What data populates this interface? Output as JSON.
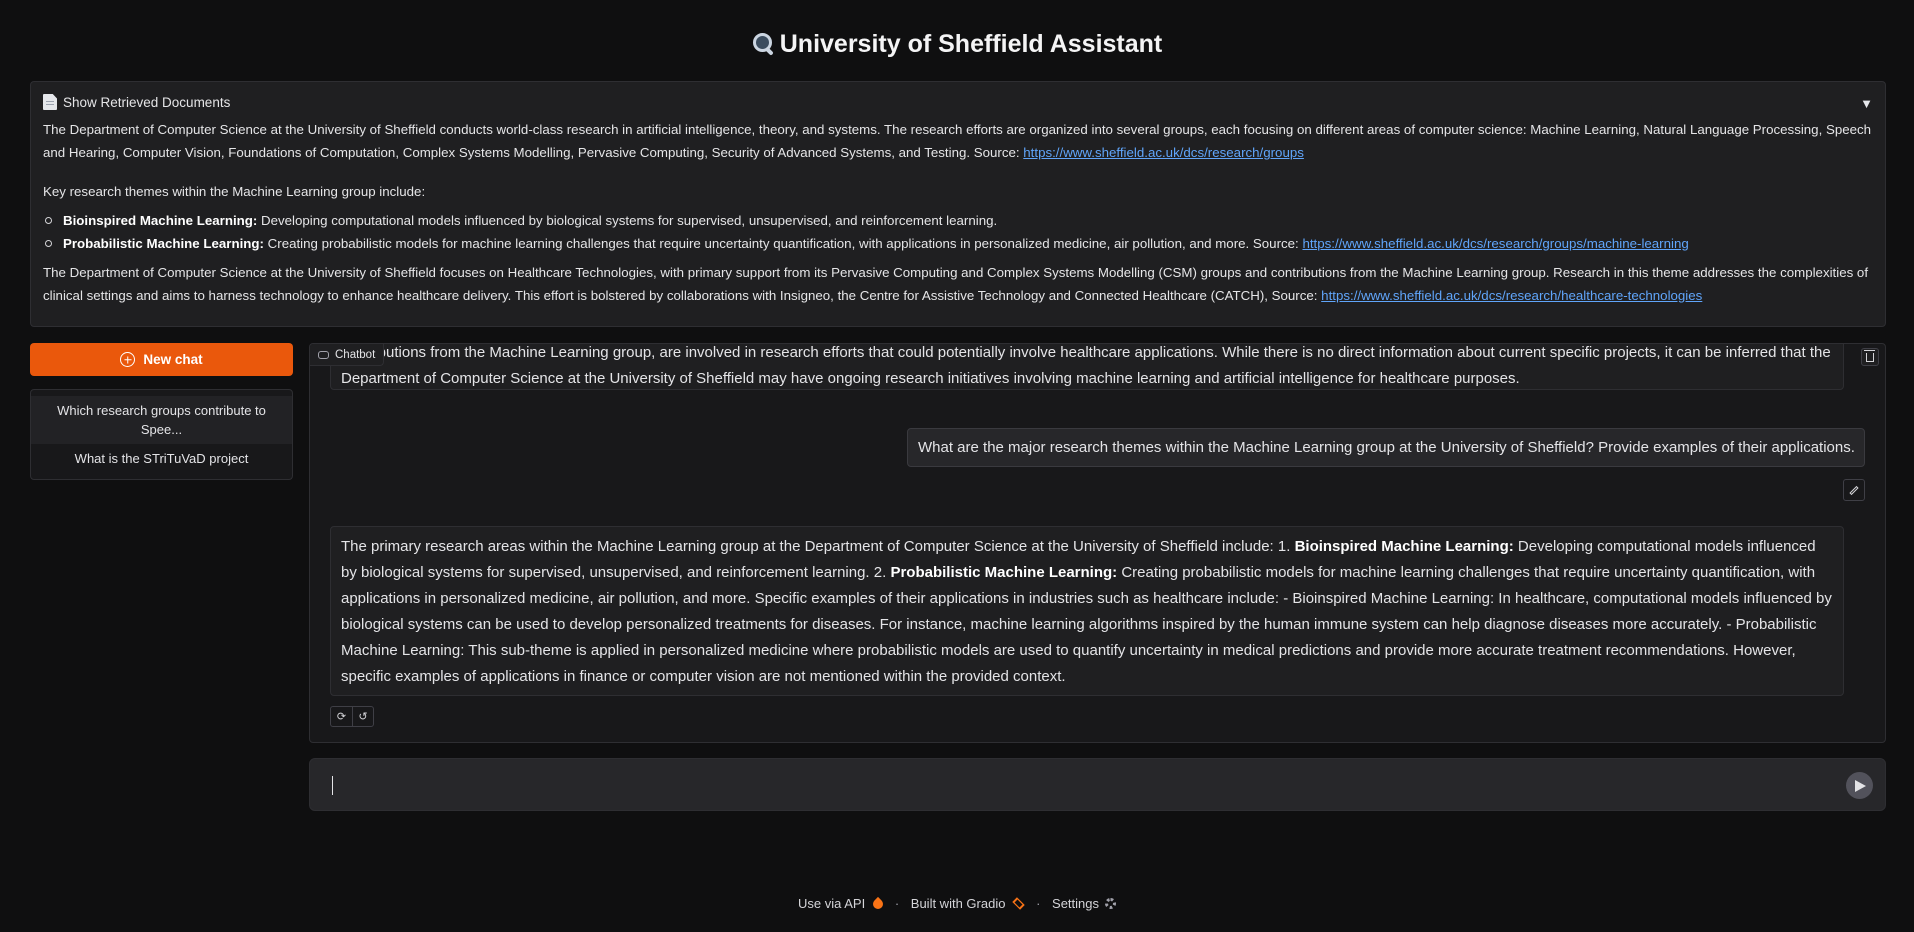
{
  "app": {
    "title": "University of Sheffield Assistant"
  },
  "docs": {
    "toggle_label": "Show Retrieved Documents",
    "toggle_arrow": "▼",
    "p1_text": "The Department of Computer Science at the University of Sheffield conducts world-class research in artificial intelligence, theory, and systems. The research efforts are organized into several groups, each focusing on different areas of computer science: Machine Learning, Natural Language Processing, Speech and Hearing, Computer Vision, Foundations of Computation, Complex Systems Modelling, Pervasive Computing, Security of Advanced Systems, and Testing. Source: ",
    "p1_link": "https://www.sheffield.ac.uk/dcs/research/groups",
    "p2_intro": "Key research themes within the Machine Learning group include:",
    "bullets": [
      {
        "bold": "Bioinspired Machine Learning:",
        "text": " Developing computational models influenced by biological systems for supervised, unsupervised, and reinforcement learning.",
        "link": ""
      },
      {
        "bold": "Probabilistic Machine Learning:",
        "text": " Creating probabilistic models for machine learning challenges that require uncertainty quantification, with applications in personalized medicine, air pollution, and more. Source: ",
        "link": "https://www.sheffield.ac.uk/dcs/research/groups/machine-learning"
      }
    ],
    "p3_text": "The Department of Computer Science at the University of Sheffield focuses on Healthcare Technologies, with primary support from its Pervasive Computing and Complex Systems Modelling (CSM) groups and contributions from the Machine Learning group. Research in this theme addresses the complexities of clinical settings and aims to harness technology to enhance healthcare delivery. This effort is bolstered by collaborations with Insigneo, the Centre for Assistive Technology and Connected Healthcare (CATCH), Source: ",
    "p3_link": "https://www.sheffield.ac.uk/dcs/research/healthcare-technologies"
  },
  "sidebar": {
    "new_chat_label": "New chat",
    "history": [
      "Which research groups contribute to Spee...",
      "What is the STriTuVaD project"
    ]
  },
  "chatbot": {
    "label": "Chatbot",
    "prev_bot_text": "contributions from the Machine Learning group, are involved in research efforts that could potentially involve healthcare applications. While there is no direct information about current specific projects, it can be inferred that the Department of Computer Science at the University of Sheffield may have ongoing research initiatives involving machine learning and artificial intelligence for healthcare purposes.",
    "user_text": "What are the major research themes within the Machine Learning group at the University of Sheffield? Provide examples of their applications.",
    "bot": {
      "part1": "The primary research areas within the Machine Learning group at the Department of Computer Science at the University of Sheffield include: 1. ",
      "bold1": "Bioinspired Machine Learning:",
      "part2": " Developing computational models influenced by biological systems for supervised, unsupervised, and reinforcement learning. 2. ",
      "bold2": "Probabilistic Machine Learning:",
      "part3": " Creating probabilistic models for machine learning challenges that require uncertainty quantification, with applications in personalized medicine, air pollution, and more. Specific examples of their applications in industries such as healthcare include: - Bioinspired Machine Learning: In healthcare, computational models influenced by biological systems can be used to develop personalized treatments for diseases. For instance, machine learning algorithms inspired by the human immune system can help diagnose diseases more accurately. - Probabilistic Machine Learning: This sub-theme is applied in personalized medicine where probabilistic models are used to quantify uncertainty in medical predictions and provide more accurate treatment recommendations. However, specific examples of applications in finance or computer vision are not mentioned within the provided context."
    },
    "retry_glyph": "⟳",
    "undo_glyph": "↺"
  },
  "input": {
    "value": "",
    "placeholder": ""
  },
  "footer": {
    "api": "Use via API",
    "built": "Built with Gradio",
    "settings": "Settings",
    "sep": "·"
  },
  "colors": {
    "accent": "#ea580c",
    "link": "#60a5fa",
    "background": "#0f0f10"
  }
}
